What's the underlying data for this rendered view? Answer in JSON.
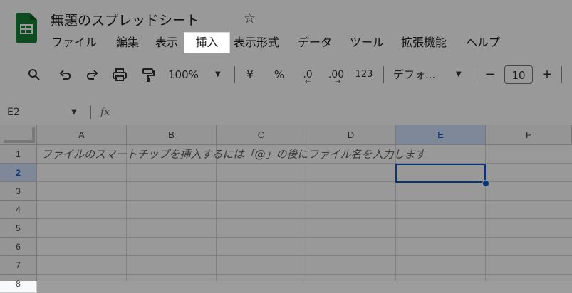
{
  "app": {
    "title": "無題のスプレッドシート",
    "star_icon": "star-icon",
    "logo_icon": "sheets-logo-icon",
    "accent_color": "#188038"
  },
  "menu": {
    "items": [
      {
        "label": "ファイル",
        "active": false
      },
      {
        "label": "編集",
        "active": false
      },
      {
        "label": "表示",
        "active": false
      },
      {
        "label": "挿入",
        "active": true
      },
      {
        "label": "表示形式",
        "active": false
      },
      {
        "label": "データ",
        "active": false
      },
      {
        "label": "ツール",
        "active": false
      },
      {
        "label": "拡張機能",
        "active": false
      },
      {
        "label": "ヘルプ",
        "active": false
      }
    ]
  },
  "toolbar": {
    "zoom": "100%",
    "currency": "¥",
    "percent": "%",
    "dec_decrease": ".0",
    "dec_increase": ".00",
    "number_format": "123",
    "font_name": "デフォ...",
    "minus": "−",
    "font_size": "10",
    "plus": "+"
  },
  "formula_bar": {
    "name_box": "E2",
    "fx": "fx"
  },
  "grid": {
    "columns": [
      "A",
      "B",
      "C",
      "D",
      "E",
      "F"
    ],
    "rows": [
      "1",
      "2",
      "3",
      "4",
      "5",
      "6",
      "7",
      "8"
    ],
    "selected_cell": "E2",
    "hint_text": "ファイルのスマートチップを挿入するには「@」の後にファイル名を入力します",
    "selection_color": "#0b57d0"
  }
}
